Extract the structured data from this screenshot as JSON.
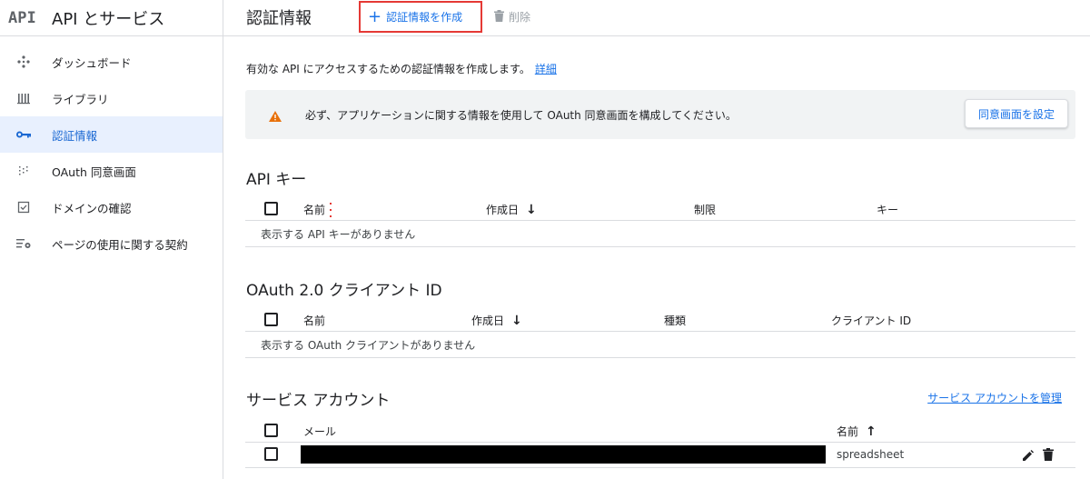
{
  "sidebar": {
    "logo": "API",
    "title": "API とサービス",
    "items": [
      {
        "label": "ダッシュボード",
        "icon": "dashboard-icon"
      },
      {
        "label": "ライブラリ",
        "icon": "library-icon"
      },
      {
        "label": "認証情報",
        "icon": "key-icon",
        "active": true
      },
      {
        "label": "OAuth 同意画面",
        "icon": "consent-icon"
      },
      {
        "label": "ドメインの確認",
        "icon": "checkbox-icon"
      },
      {
        "label": "ページの使用に関する契約",
        "icon": "settings-list-icon"
      }
    ]
  },
  "header": {
    "title": "認証情報",
    "create_label": "認証情報を作成",
    "delete_label": "削除"
  },
  "intro": {
    "text": "有効な API にアクセスするための認証情報を作成します。",
    "link": "詳細"
  },
  "warning": {
    "text": "必ず、アプリケーションに関する情報を使用して OAuth 同意画面を構成してください。",
    "button": "同意画面を設定"
  },
  "api_keys": {
    "title": "API キー",
    "columns": [
      "名前",
      "作成日",
      "制限",
      "キー"
    ],
    "sort_icon": "arrow-down-icon",
    "empty": "表示する API キーがありません"
  },
  "oauth": {
    "title": "OAuth 2.0 クライアント ID",
    "columns": [
      "名前",
      "作成日",
      "種類",
      "クライアント ID"
    ],
    "sort_icon": "arrow-down-icon",
    "empty": "表示する OAuth クライアントがありません"
  },
  "service_accounts": {
    "title": "サービス アカウント",
    "manage_link": "サービス アカウントを管理",
    "columns": [
      "メール",
      "名前"
    ],
    "sort_icon": "arrow-up-icon",
    "rows": [
      {
        "email": "",
        "name": "spreadsheet"
      }
    ]
  },
  "colors": {
    "accent": "#1a73e8",
    "active_bg": "#e8f0fe",
    "highlight_border": "#e53935",
    "warning": "#e8710a"
  }
}
